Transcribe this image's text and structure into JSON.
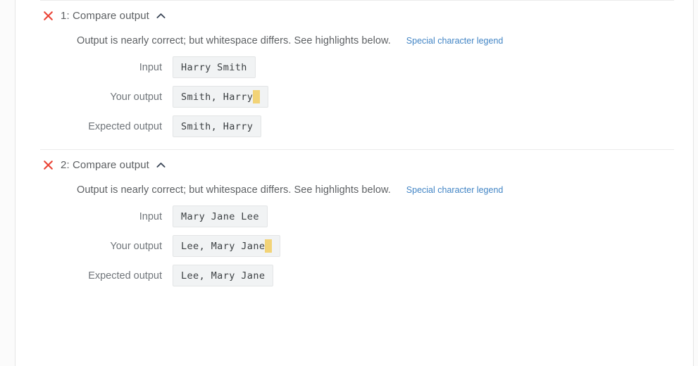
{
  "panel": {
    "legend_link_label": "Special character legend"
  },
  "icons": {
    "fail": "x-mark-icon",
    "collapse": "chevron-up-icon"
  },
  "colors": {
    "fail_icon": "#ea4335",
    "link": "#4285c5",
    "whitespace_highlight": "#f2d377",
    "value_box_bg": "#f1f3f4",
    "text_muted": "#5d6063"
  },
  "results": [
    {
      "title": "1: Compare output",
      "description": "Output is nearly correct; but whitespace differs. See highlights below.",
      "legend_link_label": "Special character legend",
      "fields": [
        {
          "label": "Input",
          "value": "Harry Smith",
          "highlight": false
        },
        {
          "label": "Your output",
          "value": "Smith, Harry",
          "highlight": true
        },
        {
          "label": "Expected output",
          "value": "Smith, Harry",
          "highlight": false
        }
      ]
    },
    {
      "title": "2: Compare output",
      "description": "Output is nearly correct; but whitespace differs. See highlights below.",
      "legend_link_label": "Special character legend",
      "fields": [
        {
          "label": "Input",
          "value": "Mary Jane Lee",
          "highlight": false
        },
        {
          "label": "Your output",
          "value": "Lee, Mary Jane",
          "highlight": true
        },
        {
          "label": "Expected output",
          "value": "Lee, Mary Jane",
          "highlight": false
        }
      ]
    }
  ]
}
